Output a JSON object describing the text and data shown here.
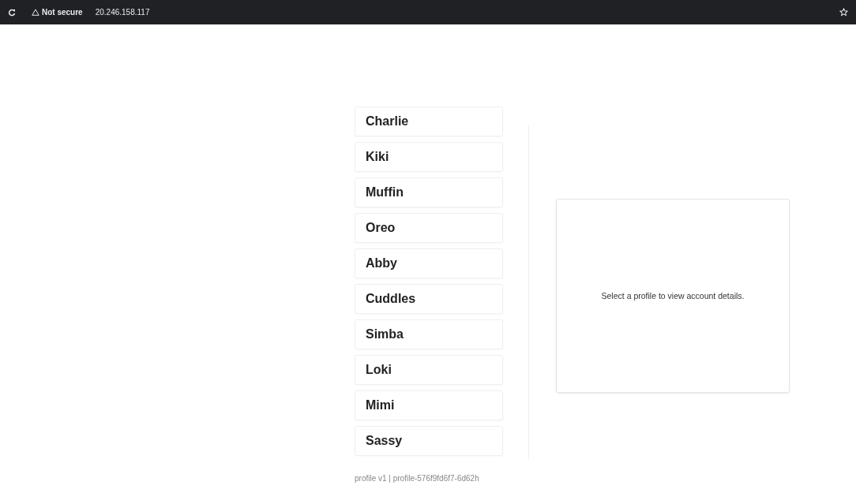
{
  "browser_bar": {
    "security": "Not secure",
    "address": "20.246.158.117"
  },
  "profiles": [
    {
      "name": "Charlie"
    },
    {
      "name": "Kiki"
    },
    {
      "name": "Muffin"
    },
    {
      "name": "Oreo"
    },
    {
      "name": "Abby"
    },
    {
      "name": "Cuddles"
    },
    {
      "name": "Simba"
    },
    {
      "name": "Loki"
    },
    {
      "name": "Mimi"
    },
    {
      "name": "Sassy"
    }
  ],
  "details": {
    "message": "Select a profile to view account details."
  },
  "footer": "profile v1 | profile-576f9fd6f7-6d62h"
}
